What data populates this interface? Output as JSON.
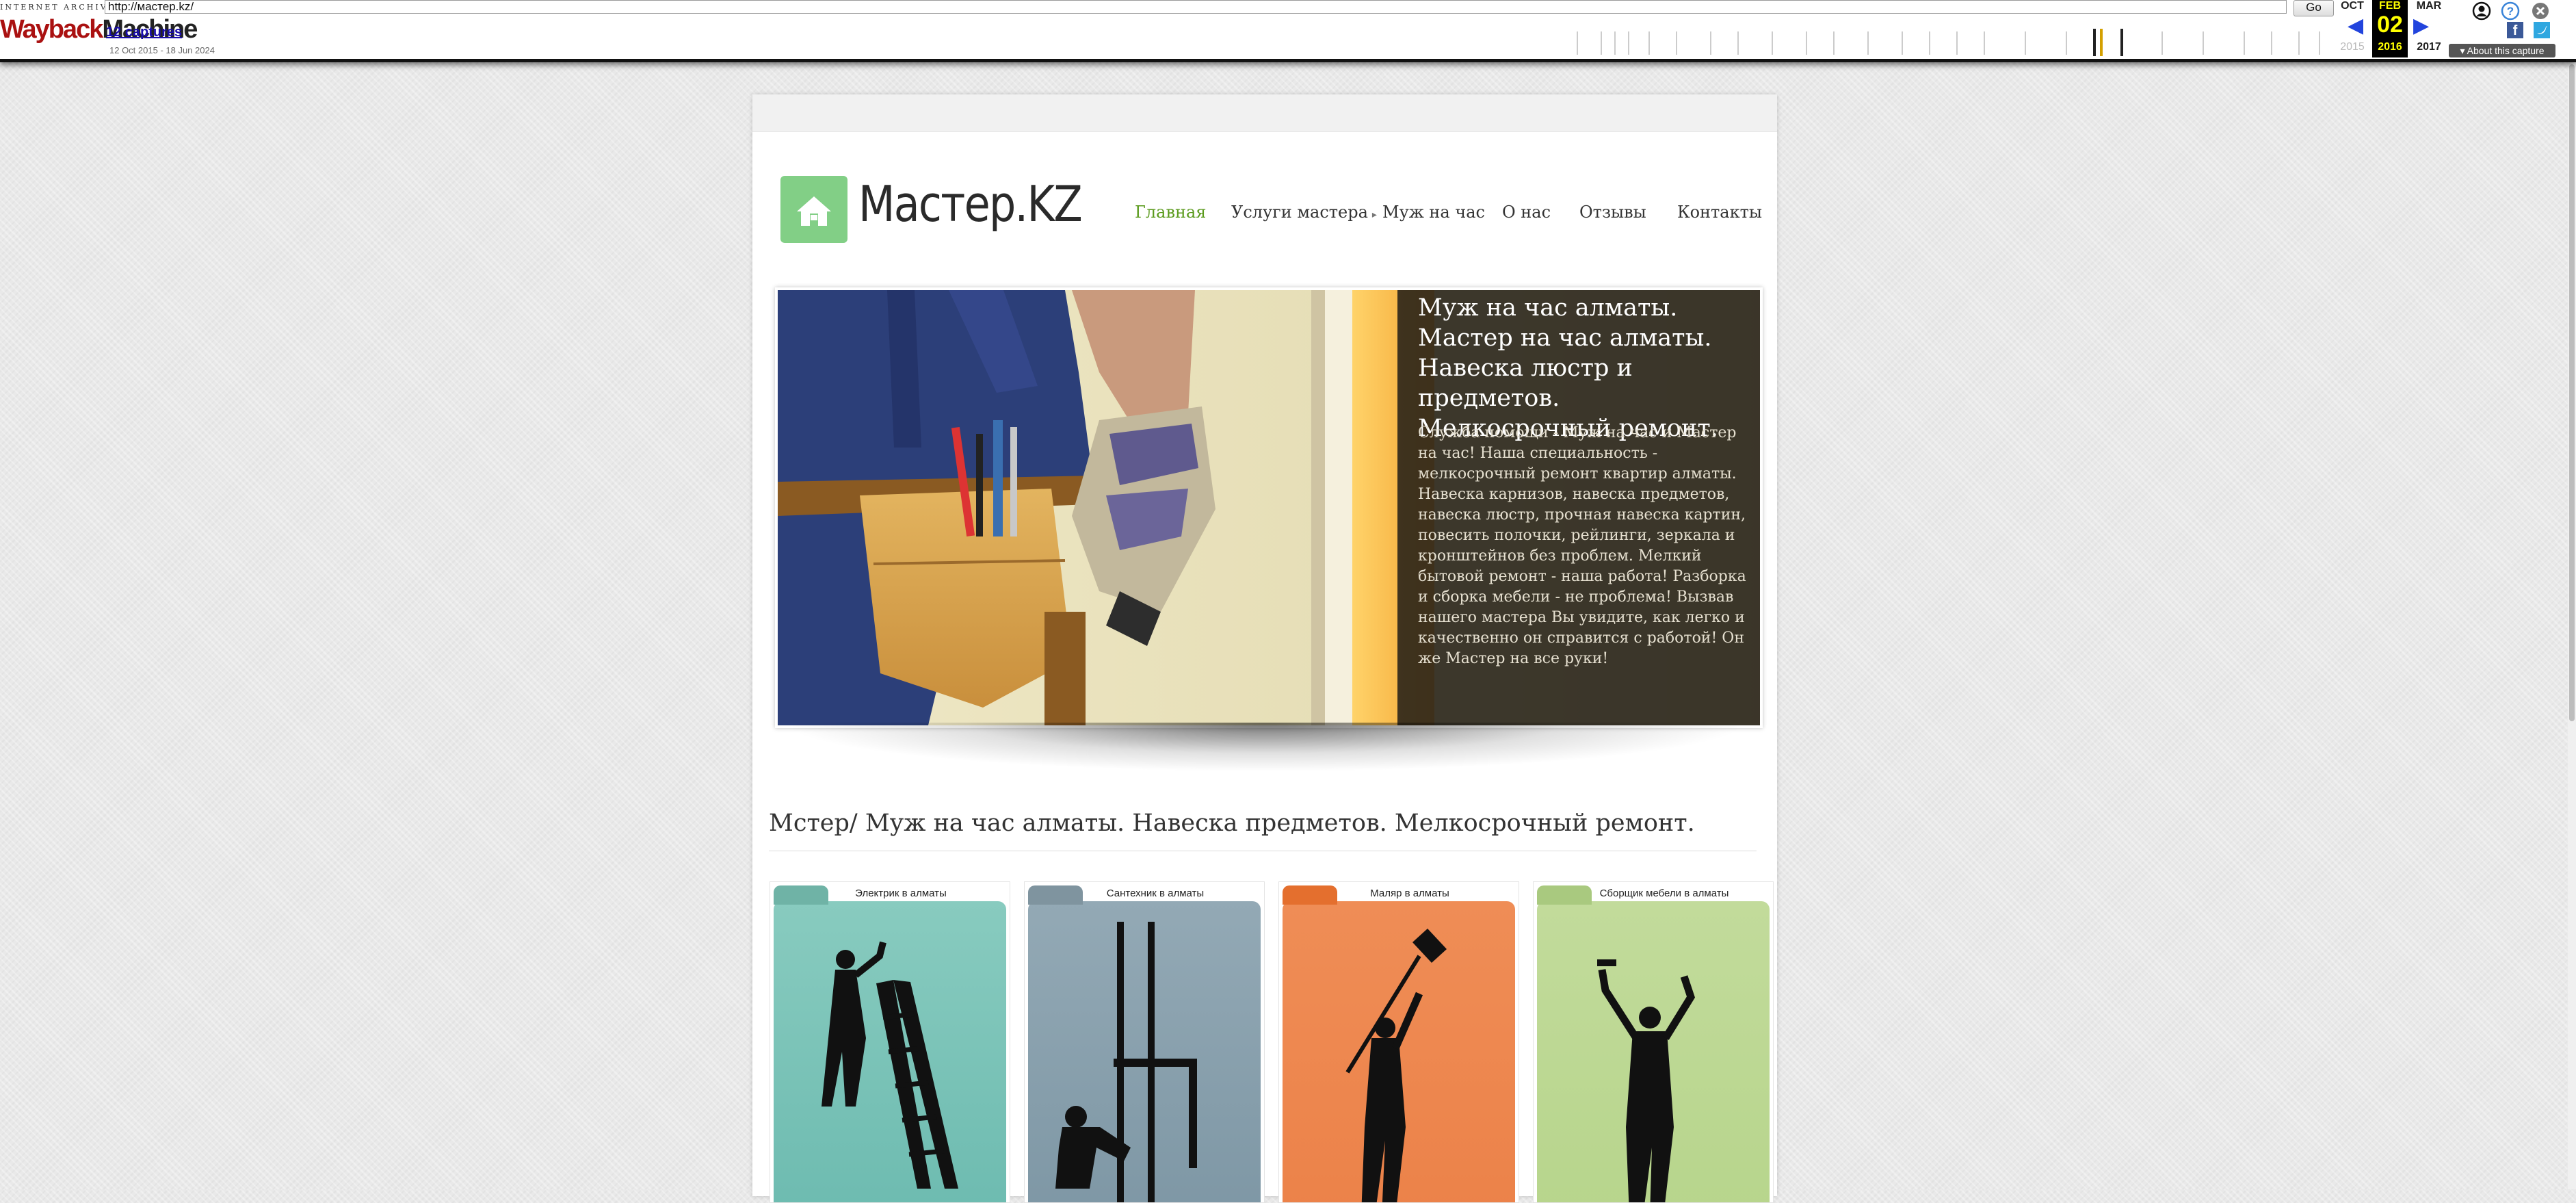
{
  "toolbar": {
    "archive_label": "INTERNET ARCHIVE",
    "logo_wayback": "Wayback",
    "logo_machine": "Machine",
    "url": "http://мастер.kz/",
    "go_label": "Go",
    "captures_label": "12 captures",
    "date_range": "12 Oct 2015 - 18 Jun 2024",
    "prev_month": "OCT",
    "current_month": "FEB",
    "next_month": "MAR",
    "current_day": "02",
    "prev_year": "2015",
    "current_year": "2016",
    "next_year": "2017",
    "about_label": "About this capture",
    "capture_ticks": [
      45,
      80,
      100,
      120,
      150,
      190,
      240,
      280,
      330,
      380,
      420,
      470,
      520,
      560,
      600,
      640,
      700,
      760,
      800,
      840,
      900,
      960,
      1020,
      1060,
      1100,
      1130
    ]
  },
  "site": {
    "logo_text": "Мастер.KZ",
    "nav": [
      {
        "label": "Главная",
        "active": true
      },
      {
        "label": "Услуги мастера",
        "has_submenu": true
      },
      {
        "label": "Муж на час"
      },
      {
        "label": "О нас"
      },
      {
        "label": "Отзывы"
      },
      {
        "label": "Контакты"
      }
    ],
    "hero": {
      "title": "Муж на час алматы. Мастер на час алматы. Навеска люстр и предметов. Мелкосрочный ремонт.",
      "text": "Служба помощи - Муж на час и Мастер на час! Наша специальность - мелкосрочный ремонт квартир алматы. Навеска карнизов, навеска предметов, навеска люстр, прочная навеска картин, повесить полочки, рейлинги, зеркала и кронштейнов без проблем. Мелкий бытовой ремонт - наша работа! Разборка и сборка мебели - не проблема! Вызвав нашего мастера Вы увидите, как легко и качественно он справится с работой! Он же Мастер на все руки!"
    },
    "main_heading": "Мстер/ Муж на час алматы. Навеска предметов. Мелкосрочный ремонт.",
    "services": [
      {
        "label": "Электрик в алматы",
        "color": "#88cbbf",
        "tab_color": "#6fb3a6"
      },
      {
        "label": "Сантехник в алматы",
        "color": "#93a9b5",
        "tab_color": "#7f949f"
      },
      {
        "label": "Маляр в алматы",
        "color": "#ef8d56",
        "tab_color": "#e46f2e"
      },
      {
        "label": "Сборщик мебели в алматы",
        "color": "#c2db9b",
        "tab_color": "#a9c97f"
      }
    ]
  }
}
